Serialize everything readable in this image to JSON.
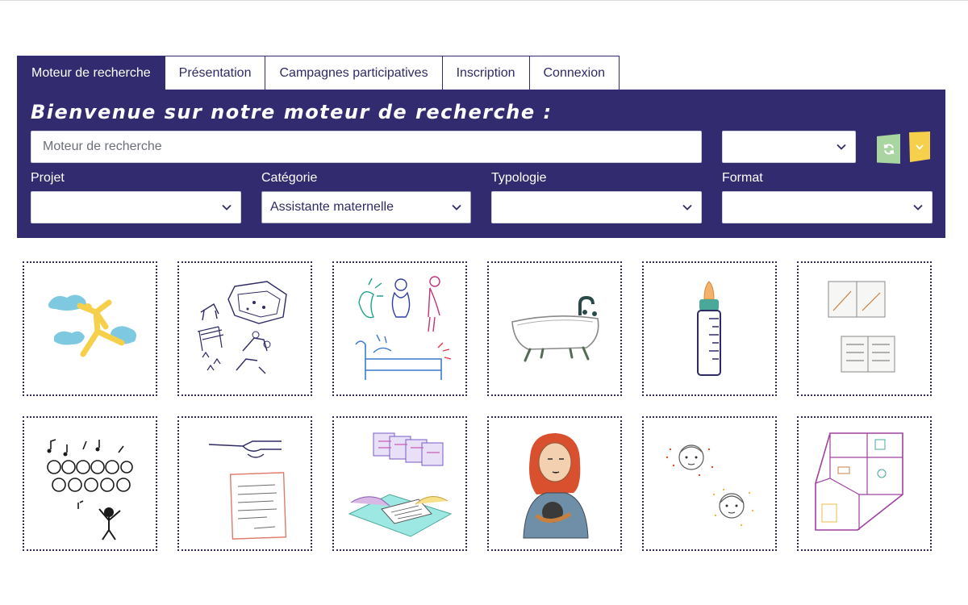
{
  "nav": {
    "tabs": [
      {
        "label": "Moteur de recherche",
        "active": true
      },
      {
        "label": "Présentation",
        "active": false
      },
      {
        "label": "Campagnes participatives",
        "active": false
      },
      {
        "label": "Inscription",
        "active": false
      },
      {
        "label": "Connexion",
        "active": false
      }
    ]
  },
  "search": {
    "title": "Bienvenue sur notre moteur de recherche :",
    "placeholder": "Moteur de recherche",
    "top_select_value": "",
    "refresh_icon": "refresh-icon",
    "expand_icon": "chevron-down-icon"
  },
  "filters": [
    {
      "label": "Projet",
      "value": ""
    },
    {
      "label": "Catégorie",
      "value": "Assistante maternelle"
    },
    {
      "label": "Typologie",
      "value": ""
    },
    {
      "label": "Format",
      "value": ""
    }
  ],
  "colors": {
    "brand": "#332b70",
    "refresh_button": "#a8d5a0",
    "expand_button": "#f6d04b"
  },
  "results": [
    {
      "name": "illustration-sky-figure"
    },
    {
      "name": "illustration-playground"
    },
    {
      "name": "illustration-sensations"
    },
    {
      "name": "illustration-bathtub"
    },
    {
      "name": "illustration-baby-bottle"
    },
    {
      "name": "illustration-documents"
    },
    {
      "name": "illustration-children-singing"
    },
    {
      "name": "illustration-handshake-letter"
    },
    {
      "name": "illustration-signing-contract"
    },
    {
      "name": "illustration-woman-baby"
    },
    {
      "name": "illustration-children-faces"
    },
    {
      "name": "illustration-apartment-plan"
    }
  ]
}
